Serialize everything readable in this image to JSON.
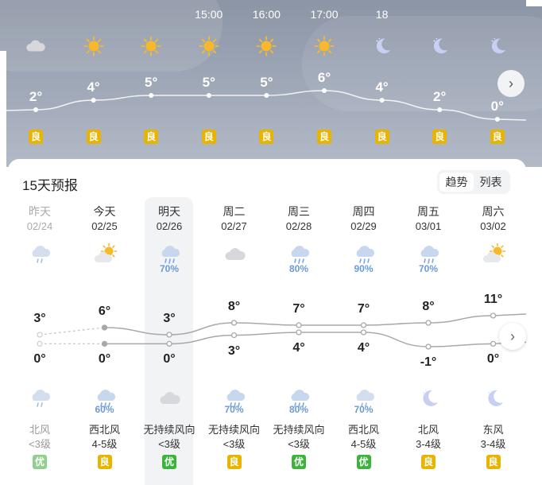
{
  "hourly": {
    "times": [
      "",
      "",
      "",
      "15:00",
      "16:00",
      "17:00",
      "18",
      "",
      ""
    ],
    "icons": [
      "cloudy-icon",
      "sun-icon",
      "sun-icon",
      "sun-icon",
      "sun-icon",
      "sun-icon",
      "moon-icon",
      "moon-icon",
      "moon-icon"
    ],
    "temps": [
      "2°",
      "4°",
      "5°",
      "5°",
      "5°",
      "6°",
      "4°",
      "2°",
      "0°"
    ],
    "temp_values": [
      2,
      4,
      5,
      5,
      5,
      6,
      4,
      2,
      0
    ],
    "aqi": [
      "良",
      "良",
      "良",
      "良",
      "良",
      "良",
      "良",
      "良",
      "良"
    ],
    "next_label": "›"
  },
  "forecast": {
    "title": "15天预报",
    "toggle": {
      "trend": "趋势",
      "list": "列表"
    },
    "next_label": "›",
    "days": [
      {
        "name": "昨天",
        "date": "02/24",
        "day_icon": "light-rain-icon",
        "day_pct": "",
        "high": "3°",
        "low": "0°",
        "night_icon": "light-rain-icon",
        "night_pct": "",
        "wind": "北风",
        "level": "<3级",
        "aqi": "优",
        "aqi_color": "#8fd08f"
      },
      {
        "name": "今天",
        "date": "02/25",
        "day_icon": "partly-cloudy-icon",
        "day_pct": "",
        "high": "6°",
        "low": "0°",
        "night_icon": "rain-icon",
        "night_pct": "60%",
        "wind": "西北风",
        "level": "4-5级",
        "aqi": "良",
        "aqi_color": "#e8b400"
      },
      {
        "name": "明天",
        "date": "02/26",
        "day_icon": "rain-icon",
        "day_pct": "70%",
        "high": "3°",
        "low": "0°",
        "night_icon": "cloudy-icon",
        "night_pct": "",
        "wind": "无持续风向",
        "level": "<3级",
        "aqi": "优",
        "aqi_color": "#3cb43c"
      },
      {
        "name": "周二",
        "date": "02/27",
        "day_icon": "cloudy-icon",
        "day_pct": "",
        "high": "8°",
        "low": "3°",
        "night_icon": "rain-icon",
        "night_pct": "70%",
        "wind": "无持续风向",
        "level": "<3级",
        "aqi": "良",
        "aqi_color": "#e8b400"
      },
      {
        "name": "周三",
        "date": "02/28",
        "day_icon": "rain-icon",
        "day_pct": "80%",
        "high": "7°",
        "low": "4°",
        "night_icon": "rain-icon",
        "night_pct": "80%",
        "wind": "无持续风向",
        "level": "<3级",
        "aqi": "优",
        "aqi_color": "#3cb43c"
      },
      {
        "name": "周四",
        "date": "02/29",
        "day_icon": "rain-icon",
        "day_pct": "90%",
        "high": "7°",
        "low": "4°",
        "night_icon": "light-rain-icon",
        "night_pct": "70%",
        "wind": "西北风",
        "level": "4-5级",
        "aqi": "优",
        "aqi_color": "#3cb43c"
      },
      {
        "name": "周五",
        "date": "03/01",
        "day_icon": "rain-icon",
        "day_pct": "70%",
        "high": "8°",
        "low": "-1°",
        "night_icon": "moon-icon",
        "night_pct": "",
        "wind": "北风",
        "level": "3-4级",
        "aqi": "良",
        "aqi_color": "#e8b400"
      },
      {
        "name": "周六",
        "date": "03/02",
        "day_icon": "partly-cloudy-icon",
        "day_pct": "",
        "high": "11°",
        "low": "0°",
        "night_icon": "moon-icon",
        "night_pct": "",
        "wind": "东风",
        "level": "3-4级",
        "aqi": "良",
        "aqi_color": "#e8b400"
      }
    ],
    "high_values": [
      3,
      6,
      3,
      8,
      7,
      7,
      8,
      11
    ],
    "low_values": [
      0,
      0,
      0,
      3,
      4,
      4,
      -1,
      0
    ]
  }
}
